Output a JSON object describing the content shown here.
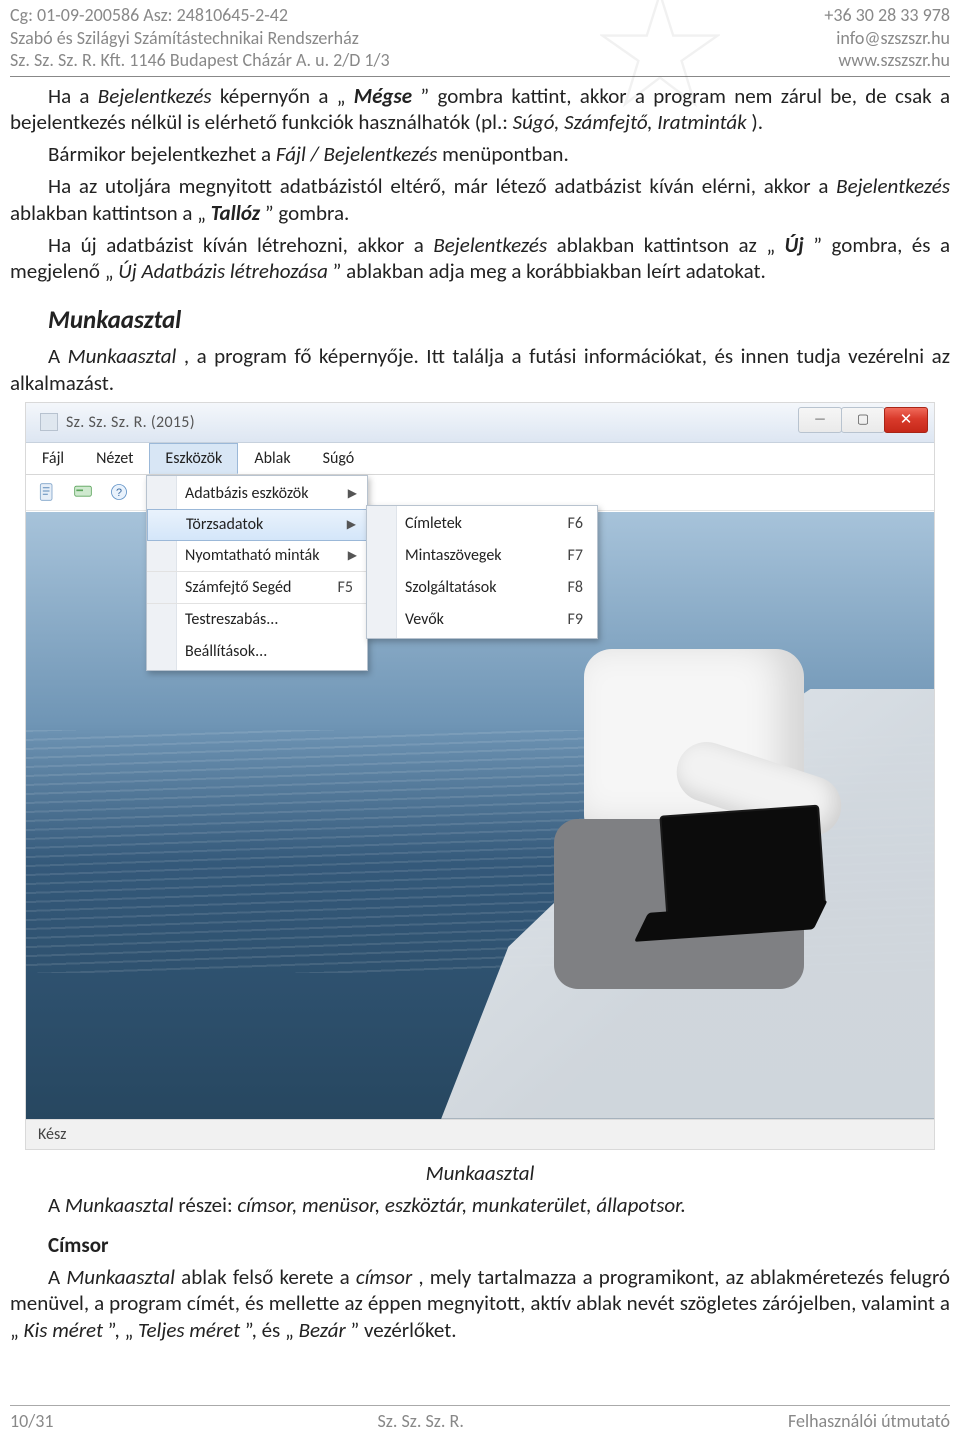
{
  "header": {
    "left": "Cg: 01-09-200586 Asz: 24810645-2-42\nSzabó és Szilágyi Számítástechnikai Rendszerház\nSz. Sz. Sz. R. Kft. 1146 Budapest Cházár A. u. 2/D 1/3",
    "right": "+36 30 28 33 978\ninfo@szszszr.hu\nwww.szszszr.hu"
  },
  "para1": {
    "t1": "Ha a ",
    "i1": "Bejelentkezés",
    "t2": " képernyőn a „",
    "b1": "Mégse",
    "t3": "” gombra kattint, akkor a program nem zárul be, de csak a bejelentkezés nélkül is elérhető funkciók használhatók (pl.: ",
    "i2": "Súgó, Számfejtő, Iratminták",
    "t4": ")."
  },
  "para2": {
    "t1": "Bármikor bejelentkezhet a ",
    "i1": "Fájl / Bejelentkezés",
    "t2": " menüpontban."
  },
  "para3": {
    "t1": "Ha az utoljára megnyitott adatbázistól eltérő, már létező adatbázist kíván elérni, akkor a ",
    "i1": "Bejelentkezés",
    "t2": " ablakban kattintson a „",
    "b1": "Tallóz",
    "t3": "” gombra."
  },
  "para4": {
    "t1": "Ha új adatbázist kíván létrehozni, akkor a ",
    "i1": "Bejelentkezés",
    "t2": " ablakban kattintson az „",
    "b1": "Új",
    "t3": "” gombra, és a megjelenő „",
    "i2": "Új Adatbázis létrehozása",
    "t4": "” ablakban adja meg a korábbiakban leírt adatokat."
  },
  "section1": "Munkaasztal",
  "para5": {
    "t1": "A ",
    "i1": "Munkaasztal",
    "t2": ", a program fő képernyője. Itt találja a futási információkat, és innen tudja vezérelni az alkalmazást."
  },
  "screenshot": {
    "title": "Sz. Sz. Sz. R. (2015)",
    "menubar": [
      "Fájl",
      "Nézet",
      "Eszközök",
      "Ablak",
      "Súgó"
    ],
    "open_menu_index": 2,
    "dropdown": [
      {
        "label": "Adatbázis eszközök",
        "arrow": true
      },
      {
        "label": "Törzsadatok",
        "arrow": true,
        "selected": true
      },
      {
        "label": "Nyomtatható minták",
        "arrow": true,
        "sep_after": true
      },
      {
        "label": "Számfejtő Segéd",
        "shortcut": "F5",
        "sep_after": true
      },
      {
        "label": "Testreszabás..."
      },
      {
        "label": "Beállítások..."
      }
    ],
    "submenu": [
      {
        "label": "Címletek",
        "shortcut": "F6"
      },
      {
        "label": "Mintaszövegek",
        "shortcut": "F7"
      },
      {
        "label": "Szolgáltatások",
        "shortcut": "F8"
      },
      {
        "label": "Vevők",
        "shortcut": "F9"
      }
    ],
    "status": "Kész"
  },
  "caption1": "Munkaasztal",
  "para6": {
    "t1": "A ",
    "i1": "Munkaasztal",
    "t2": " részei: ",
    "i2": "címsor, menüsor, eszköztár, munkaterület, állapotsor.",
    "t3": ""
  },
  "subsection1": "Címsor",
  "para7": {
    "t1": "A ",
    "i1": "Munkaasztal",
    "t2": " ablak felső kerete a ",
    "i2": "címsor",
    "t3": ", mely tartalmazza a programikont, az ablakméretezés felugró menüvel, a program címét, és mellette az éppen megnyitott, aktív ablak nevét szögletes zárójelben, valamint a „",
    "i3": "Kis méret",
    "t4": "”, „",
    "i4": "Teljes méret",
    "t5": "”, és „",
    "i5": "Bezár",
    "t6": "” vezérlőket."
  },
  "footer": {
    "left": "10/31",
    "center": "Sz. Sz. Sz. R.",
    "right": "Felhasználói útmutató"
  }
}
